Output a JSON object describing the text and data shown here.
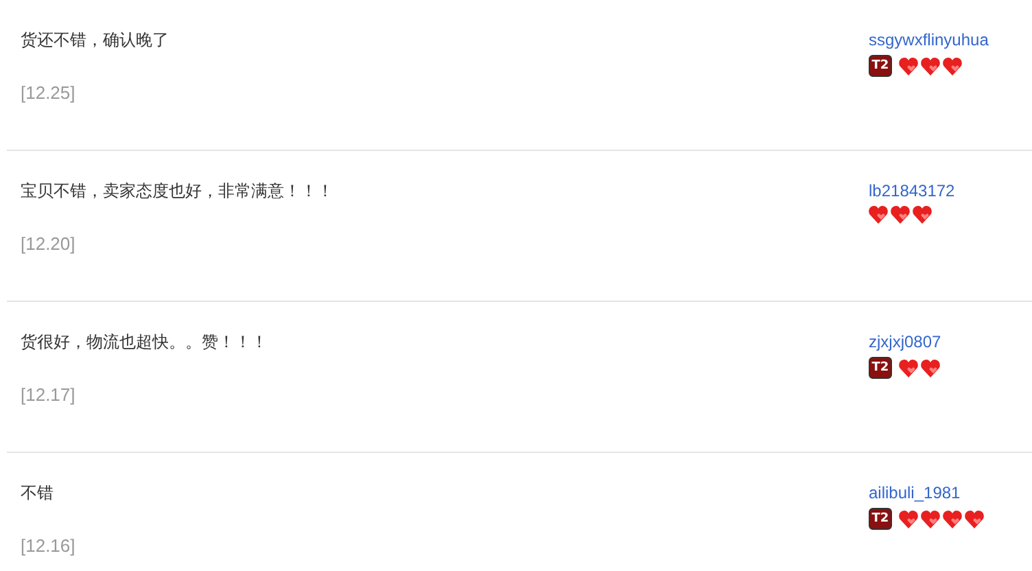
{
  "reviews": [
    {
      "comment": "货还不错，确认晚了",
      "date": "[12.25]",
      "user": "ssgywxflinyuhua",
      "icons": [
        {
          "kind": "badge",
          "label": "T2"
        },
        {
          "kind": "heart"
        },
        {
          "kind": "heart"
        },
        {
          "kind": "heart"
        }
      ]
    },
    {
      "comment": "宝贝不错，卖家态度也好，非常满意！！！",
      "date": "[12.20]",
      "user": "lb21843172",
      "icons": [
        {
          "kind": "heart"
        },
        {
          "kind": "heart"
        },
        {
          "kind": "heart"
        }
      ]
    },
    {
      "comment": "货很好，物流也超快。。赞！！！",
      "date": "[12.17]",
      "user": "zjxjxj0807",
      "icons": [
        {
          "kind": "badge",
          "label": "T2"
        },
        {
          "kind": "heart"
        },
        {
          "kind": "heart"
        }
      ]
    },
    {
      "comment": "不错",
      "date": "[12.16]",
      "user": "ailibuli_1981",
      "icons": [
        {
          "kind": "badge",
          "label": "T2"
        },
        {
          "kind": "heart"
        },
        {
          "kind": "heart"
        },
        {
          "kind": "heart"
        },
        {
          "kind": "heart"
        }
      ]
    }
  ]
}
